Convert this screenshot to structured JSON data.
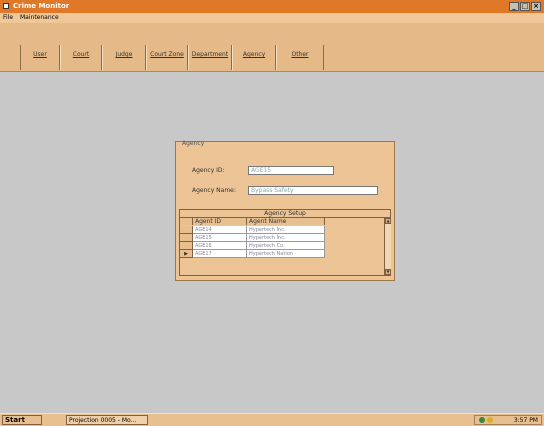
{
  "window": {
    "title": "Crime Monitor"
  },
  "menu": {
    "file": "File",
    "maintenance": "Maintenance"
  },
  "toolbar": {
    "buttons": [
      "User",
      "Court",
      "Judge",
      "Court Zone",
      "Department",
      "Agency",
      "Other"
    ]
  },
  "form": {
    "group_title": "Agency",
    "agency_id_label": "Agency ID:",
    "agency_id_value": "AGE15",
    "agency_name_label": "Agency Name:",
    "agency_name_value": "Bypass Safety"
  },
  "grid": {
    "caption": "Agency Setup",
    "columns": [
      "Agent ID",
      "Agent Name"
    ],
    "rows": [
      {
        "id": "AGE14",
        "name": "Hypertech Inc."
      },
      {
        "id": "AGE15",
        "name": "Hypertech Inc."
      },
      {
        "id": "AGE16",
        "name": "Hypertech Co."
      },
      {
        "id": "AGE17",
        "name": "Hypertech Nation"
      }
    ]
  },
  "taskbar": {
    "start": "Start",
    "task": "Projection 0005 - Mo...",
    "clock": "3:57 PM"
  },
  "colors": {
    "titlebar": "#e07828",
    "toolbar": "#e6ba88",
    "panel": "#ecc496",
    "desktop": "#c8c8c8"
  }
}
